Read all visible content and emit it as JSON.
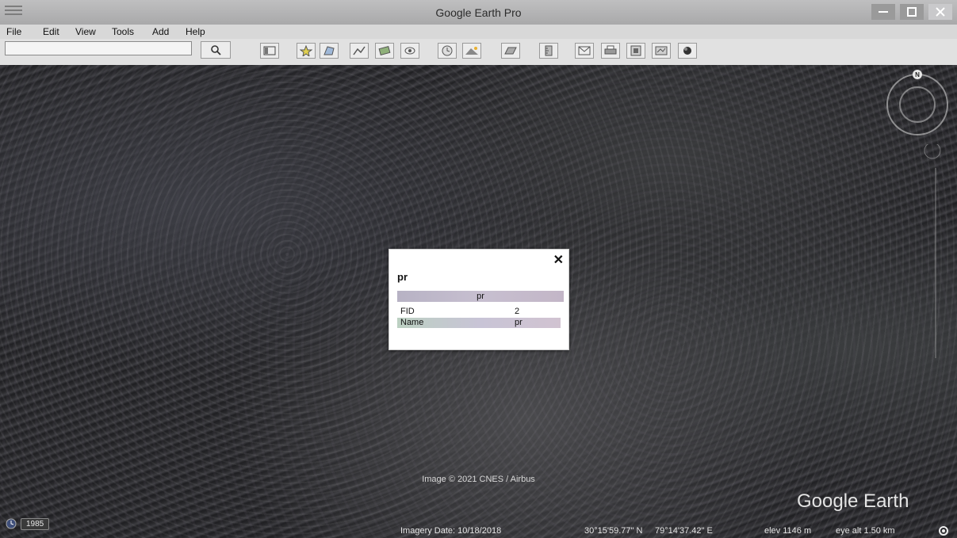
{
  "window": {
    "title": "Google Earth Pro"
  },
  "menu": {
    "items": [
      "File",
      "Edit",
      "View",
      "Tools",
      "Add",
      "Help"
    ]
  },
  "search": {
    "value": ""
  },
  "toolbar": {
    "icons": [
      "sidebar-icon",
      "placemark-icon",
      "polygon-icon",
      "path-icon",
      "overlay-icon",
      "tour-icon",
      "historical-imagery-icon",
      "sunlight-icon",
      "planets-icon",
      "ruler-icon",
      "email-icon",
      "print-icon",
      "save-image-icon",
      "maps-icon",
      "google-icon"
    ]
  },
  "popup": {
    "title": "pr",
    "header": "pr",
    "rows": [
      {
        "key": "FID",
        "value": "2"
      },
      {
        "key": "Name",
        "value": "pr"
      }
    ]
  },
  "map": {
    "copyright": "Image © 2021 CNES / Airbus",
    "brand": "Google Earth",
    "year": "1985"
  },
  "status": {
    "imagery_date": "Imagery Date: 10/18/2018",
    "lat": "30°15'59.77\" N",
    "lon": "79°14'37.42\" E",
    "elev": "elev  1146 m",
    "eye_alt": "eye alt   1.50 km"
  }
}
